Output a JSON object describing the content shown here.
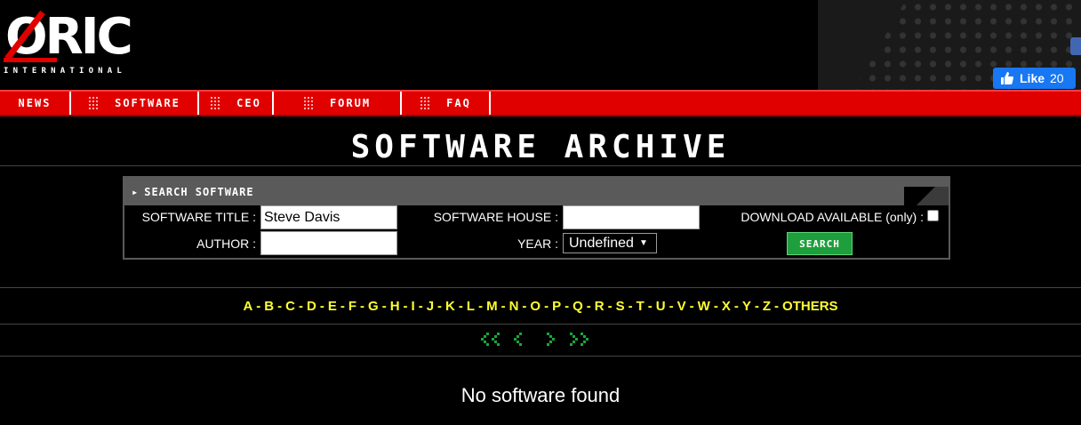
{
  "brand": {
    "logo_text": "ORIC",
    "logo_sub": "INTERNATIONAL",
    "fb_like_label": "Like",
    "fb_like_count": "20"
  },
  "nav": [
    {
      "label": "NEWS"
    },
    {
      "label": "SOFTWARE"
    },
    {
      "label": "CEO"
    },
    {
      "label": "FORUM"
    },
    {
      "label": "FAQ"
    }
  ],
  "page_title": "SOFTWARE ARCHIVE",
  "search": {
    "heading": "SEARCH SOFTWARE",
    "title_label": "SOFTWARE TITLE :",
    "title_value": "Steve Davis",
    "house_label": "SOFTWARE HOUSE :",
    "house_value": "",
    "download_label": "DOWNLOAD AVAILABLE (only) :",
    "author_label": "AUTHOR :",
    "author_value": "",
    "year_label": "YEAR :",
    "year_value": "Undefined",
    "button_label": "SEARCH"
  },
  "alphabet": [
    "A",
    "B",
    "C",
    "D",
    "E",
    "F",
    "G",
    "H",
    "I",
    "J",
    "K",
    "L",
    "M",
    "N",
    "O",
    "P",
    "Q",
    "R",
    "S",
    "T",
    "U",
    "V",
    "W",
    "X",
    "Y",
    "Z",
    "OTHERS"
  ],
  "pager": [
    "first-page-icon",
    "prev-page-icon",
    "next-page-icon",
    "last-page-icon"
  ],
  "results_message": "No software found",
  "colors": {
    "nav_red": "#e00000",
    "link_yellow": "#ffff33",
    "button_green": "#1e9e3c",
    "pager_green": "#1aa63a",
    "fb_blue": "#1877f2"
  }
}
